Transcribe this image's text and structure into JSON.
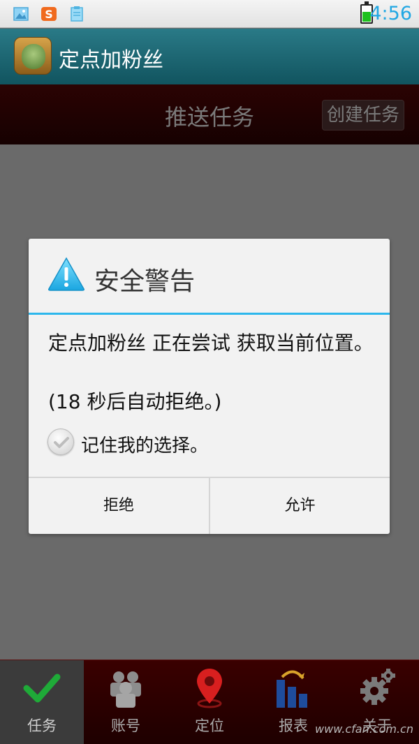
{
  "status_bar": {
    "time": "4:56",
    "icons": [
      "image-icon",
      "sogou-s-icon",
      "clipboard-icon"
    ],
    "battery_level": 0.5
  },
  "app": {
    "title": "定点加粉丝"
  },
  "page": {
    "title": "推送任务",
    "create_button": "创建任务"
  },
  "dialog": {
    "title": "安全警告",
    "message": "定点加粉丝 正在尝试 获取当前位置。",
    "countdown": "(18 秒后自动拒绝。)",
    "remember_label": "记住我的选择。",
    "remember_checked": false,
    "deny_label": "拒绝",
    "allow_label": "允许"
  },
  "bottom_nav": {
    "items": [
      {
        "label": "任务",
        "icon": "checkmark-icon",
        "active": true
      },
      {
        "label": "账号",
        "icon": "people-icon",
        "active": false
      },
      {
        "label": "定位",
        "icon": "map-pin-icon",
        "active": false
      },
      {
        "label": "报表",
        "icon": "bar-chart-icon",
        "active": false
      },
      {
        "label": "关于",
        "icon": "gear-icon",
        "active": false
      }
    ]
  },
  "watermark": "www.cfan.com.cn",
  "colors": {
    "accent": "#2cb7ec",
    "appbar": "#1a6570",
    "pagehead": "#2b0303",
    "time": "#21a7e3",
    "battery": "#1ec11e",
    "check_green": "#1faa38",
    "pin_red": "#d81f1f",
    "chart_blue": "#1e4c9c"
  }
}
